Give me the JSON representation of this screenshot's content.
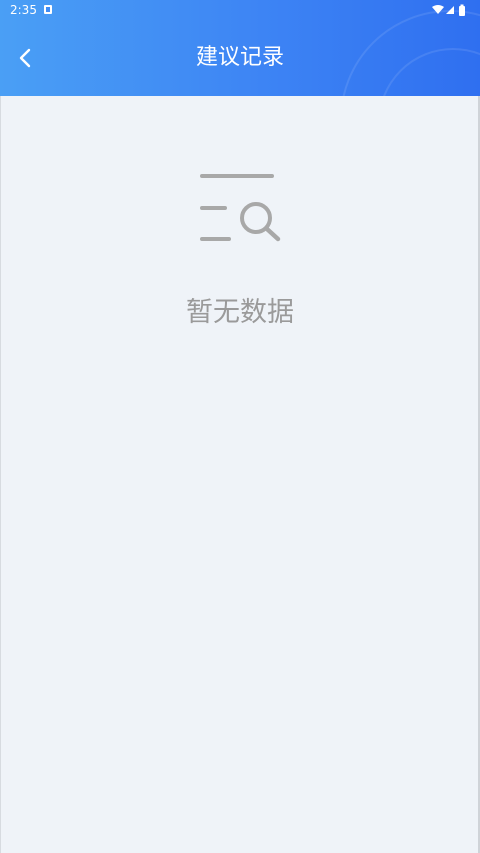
{
  "status_bar": {
    "time": "2:35",
    "icons": [
      "notification-icon",
      "wifi-icon",
      "signal-icon",
      "battery-icon"
    ]
  },
  "header": {
    "title": "建议记录",
    "back_icon": "chevron-left-icon"
  },
  "empty_state": {
    "icon": "search-list-icon",
    "message": "暂无数据"
  },
  "colors": {
    "header_start": "#4a9ff5",
    "header_end": "#2f6ff0",
    "background": "#eff3f8",
    "empty_text": "#9a9a9a",
    "empty_icon": "#a8a8a8"
  }
}
